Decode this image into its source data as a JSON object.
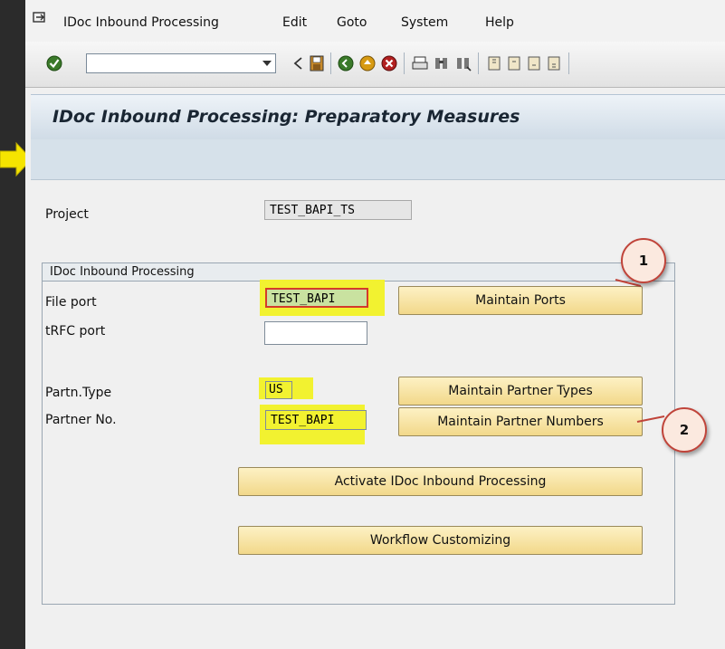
{
  "menu": {
    "items": [
      "IDoc Inbound Processing",
      "Edit",
      "Goto",
      "System",
      "Help"
    ]
  },
  "toolbar": {
    "command_value": "",
    "icons": [
      "enter-icon",
      "back-icon",
      "save-icon",
      "forward-icon",
      "exit-icon",
      "cancel-icon",
      "print-icon",
      "find-icon",
      "find-next-icon",
      "first-page-icon",
      "prev-page-icon",
      "next-page-icon",
      "last-page-icon"
    ]
  },
  "page": {
    "title": "IDoc Inbound Processing: Preparatory Measures"
  },
  "form": {
    "project_label": "Project",
    "project_value": "TEST_BAPI_TS",
    "group_title": "IDoc Inbound Processing",
    "file_port_label": "File port",
    "file_port_value": "TEST_BAPI",
    "trfc_port_label": "tRFC port",
    "trfc_port_value": "",
    "partn_type_label": "Partn.Type",
    "partn_type_value": "US",
    "partner_no_label": "Partner No.",
    "partner_no_value": "TEST_BAPI"
  },
  "buttons": {
    "maintain_ports": "Maintain Ports",
    "maintain_partner_types": "Maintain Partner Types",
    "maintain_partner_numbers": "Maintain Partner Numbers",
    "activate": "Activate IDoc Inbound Processing",
    "workflow": "Workflow Customizing"
  },
  "annotations": {
    "callout_1": "1",
    "callout_2": "2"
  },
  "colors": {
    "highlight": "#f2f230",
    "callout_border": "#c0443a",
    "arrow": "#f5e400",
    "button_bg": "#f2d88a"
  }
}
